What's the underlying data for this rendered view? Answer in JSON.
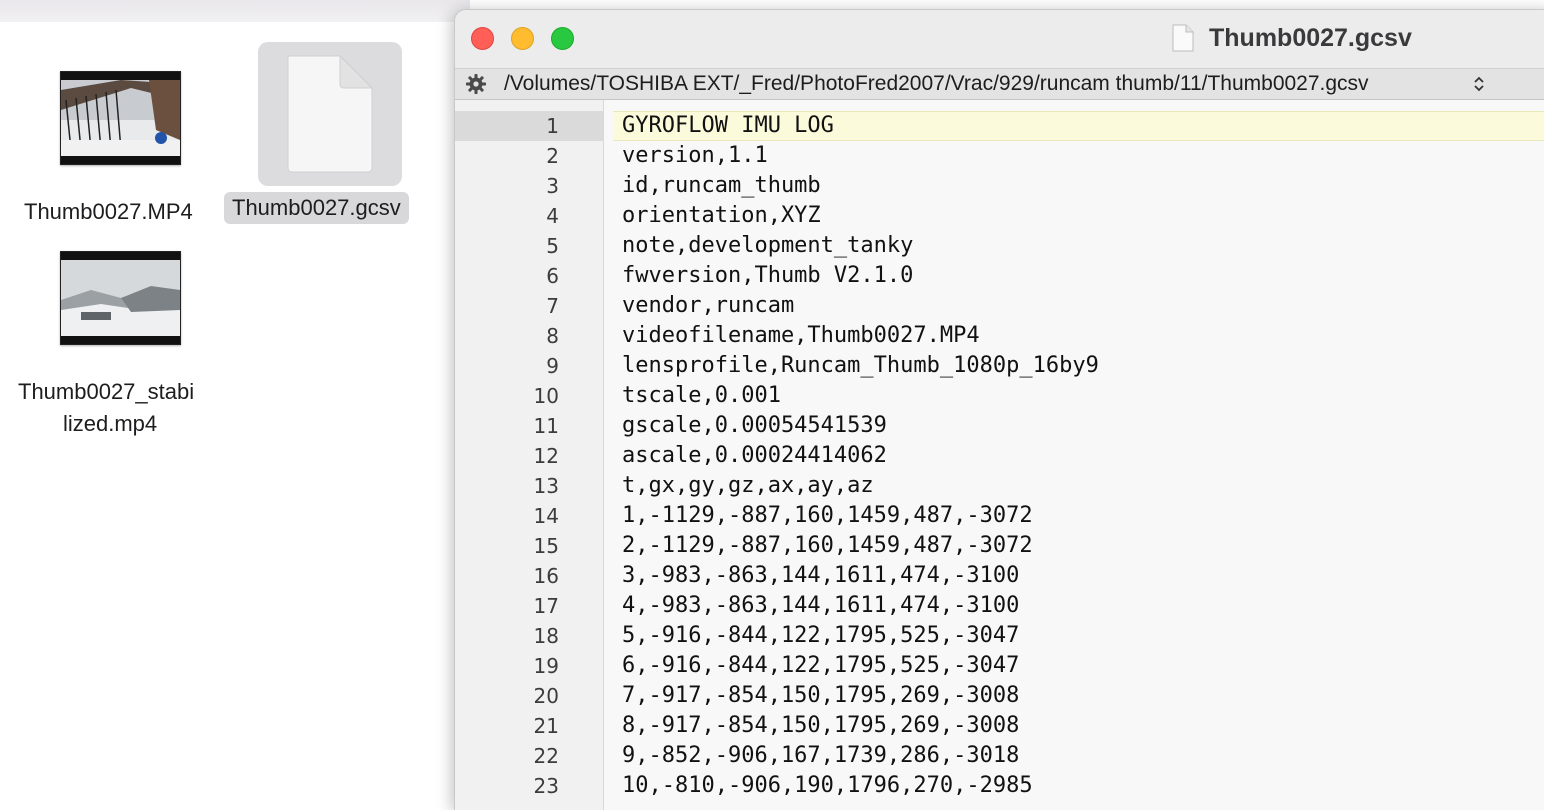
{
  "desktop": {
    "files": [
      {
        "name": "Thumb0027.MP4",
        "kind": "video"
      },
      {
        "name": "Thumb0027.gcsv",
        "kind": "document",
        "selected": true
      },
      {
        "name_line1": "Thumb0027_stabi",
        "name_line2": "lized.mp4",
        "kind": "video"
      }
    ]
  },
  "window": {
    "title": "Thumb0027.gcsv",
    "path": "/Volumes/TOSHIBA EXT/_Fred/PhotoFred2007/Vrac/929/runcam thumb/11/Thumb0027.gcsv",
    "current_line": 1,
    "lines": [
      {
        "num": "1",
        "text": "GYROFLOW IMU LOG"
      },
      {
        "num": "2",
        "text": "version,1.1"
      },
      {
        "num": "3",
        "text": "id,runcam_thumb"
      },
      {
        "num": "4",
        "text": "orientation,XYZ"
      },
      {
        "num": "5",
        "text": "note,development_tanky"
      },
      {
        "num": "6",
        "text": "fwversion,Thumb V2.1.0"
      },
      {
        "num": "7",
        "text": "vendor,runcam"
      },
      {
        "num": "8",
        "text": "videofilename,Thumb0027.MP4"
      },
      {
        "num": "9",
        "text": "lensprofile,Runcam_Thumb_1080p_16by9"
      },
      {
        "num": "10",
        "text": "tscale,0.001"
      },
      {
        "num": "11",
        "text": "gscale,0.00054541539"
      },
      {
        "num": "12",
        "text": "ascale,0.00024414062"
      },
      {
        "num": "13",
        "text": "t,gx,gy,gz,ax,ay,az"
      },
      {
        "num": "14",
        "text": "1,-1129,-887,160,1459,487,-3072"
      },
      {
        "num": "15",
        "text": "2,-1129,-887,160,1459,487,-3072"
      },
      {
        "num": "16",
        "text": "3,-983,-863,144,1611,474,-3100"
      },
      {
        "num": "17",
        "text": "4,-983,-863,144,1611,474,-3100"
      },
      {
        "num": "18",
        "text": "5,-916,-844,122,1795,525,-3047"
      },
      {
        "num": "19",
        "text": "6,-916,-844,122,1795,525,-3047"
      },
      {
        "num": "20",
        "text": "7,-917,-854,150,1795,269,-3008"
      },
      {
        "num": "21",
        "text": "8,-917,-854,150,1795,269,-3008"
      },
      {
        "num": "22",
        "text": "9,-852,-906,167,1739,286,-3018"
      },
      {
        "num": "23",
        "text": "10,-810,-906,190,1796,270,-2985"
      }
    ],
    "icons": {
      "title_icon": "document-icon",
      "pathbar_left": "gear-icon",
      "pathbar_right": "chevron-updown-icon"
    },
    "colors": {
      "close": "#ff5f57",
      "minimize": "#febc2e",
      "maximize": "#28c840",
      "current_line": "#fbfbdc"
    }
  }
}
